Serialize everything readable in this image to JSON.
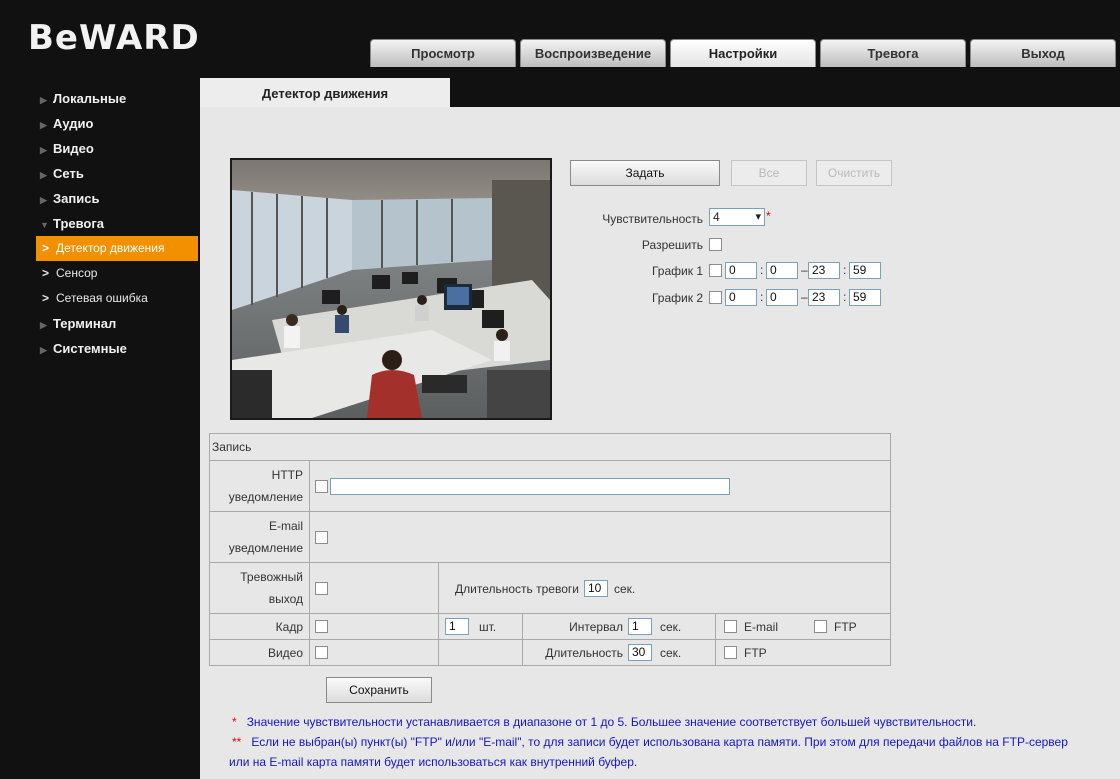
{
  "brand": {
    "logo": "BeWARD"
  },
  "tabs": [
    {
      "label": "Просмотр"
    },
    {
      "label": "Воспроизведение"
    },
    {
      "label": "Настройки"
    },
    {
      "label": "Тревога"
    },
    {
      "label": "Выход"
    }
  ],
  "active_tab": "Настройки",
  "sidebar": {
    "items": [
      {
        "label": "Локальные"
      },
      {
        "label": "Аудио"
      },
      {
        "label": "Видео"
      },
      {
        "label": "Сеть"
      },
      {
        "label": "Запись"
      },
      {
        "label": "Тревога"
      },
      {
        "label": "Терминал"
      },
      {
        "label": "Системные"
      }
    ],
    "sub_items": [
      {
        "label": "Детектор движения"
      },
      {
        "label": "Сенсор"
      },
      {
        "label": "Сетевая ошибка"
      }
    ]
  },
  "page": {
    "tab_title": "Детектор движения"
  },
  "buttons": {
    "set": "Задать",
    "all": "Все",
    "clear": "Очистить",
    "save": "Сохранить"
  },
  "settings": {
    "sensitivity_label": "Чувствительность",
    "sensitivity_value": "4",
    "required_mark": "*",
    "enable_label": "Разрешить",
    "schedule1_label": "График 1",
    "schedule2_label": "График 2",
    "schedule1": {
      "from_h": "0",
      "from_m": "0",
      "to_h": "23",
      "to_m": "59"
    },
    "schedule2": {
      "from_h": "0",
      "from_m": "0",
      "to_h": "23",
      "to_m": "59"
    },
    "sep_colon": ":",
    "sep_dash": "–"
  },
  "record": {
    "header": "Запись",
    "http_label": [
      "HTTP",
      "уведомление"
    ],
    "http_value": "",
    "email_label": [
      "E-mail",
      "уведомление"
    ],
    "alarm_out_label": [
      "Тревожный",
      "выход"
    ],
    "alarm_duration_label": "Длительность тревоги",
    "alarm_duration_value": "10",
    "sec": "сек.",
    "frame_label": "Кадр",
    "frame_count": "1",
    "pcs": "шт.",
    "interval_label": "Интервал",
    "interval_value": "1",
    "email_opt": "E-mail",
    "ftp_opt": "FTP",
    "video_label": "Видео",
    "duration_label": "Длительность",
    "duration_value": "30"
  },
  "notes": {
    "star1": "*",
    "note1": "Значение чувствительности устанавливается в диапазоне от 1 до 5. Большее значение соответствует большей чувствительности.",
    "star2": "**",
    "note2a": "Если не выбран(ы) пункт(ы) \"FTP\" и/или \"E-mail\", то для записи будет использована карта памяти. При этом для передачи файлов на FTP-сервер",
    "note2b": "или на E-mail карта памяти будет использоваться как внутренний буфер."
  }
}
